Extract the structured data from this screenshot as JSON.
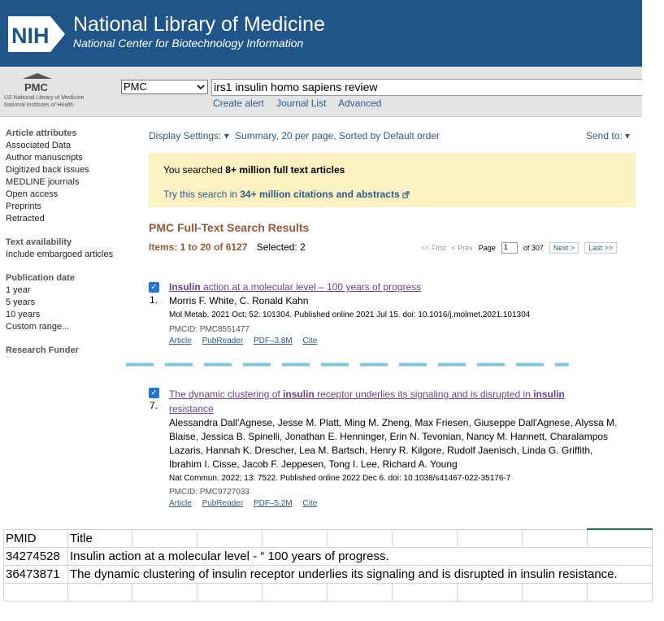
{
  "header": {
    "logo_text": "NIH",
    "title": "National Library of Medicine",
    "subtitle": "National Center for Biotechnology Information"
  },
  "search": {
    "logo_text": "PMC",
    "caption_line1": "US National Library of Medicine",
    "caption_line2": "National Institutes of Health",
    "database": "PMC",
    "query": "irs1 insulin homo sapiens review",
    "links": [
      "Create alert",
      "Journal List",
      "Advanced"
    ]
  },
  "sidebar": {
    "groups": [
      {
        "heading": "Article attributes",
        "items": [
          "Associated Data",
          "Author manuscripts",
          "Digitized back issues",
          "MEDLINE journals",
          "Open access",
          "Preprints",
          "Retracted"
        ]
      },
      {
        "heading": "Text availability",
        "items": [
          "Include embargoed articles"
        ]
      },
      {
        "heading": "Publication date",
        "items": [
          "1 year",
          "5 years",
          "10 years",
          "Custom range..."
        ]
      },
      {
        "heading": "Research Funder",
        "items": []
      }
    ]
  },
  "toolbar": {
    "display_settings": "Display Settings:",
    "display_value": "Summary, 20 per page, Sorted by Default order",
    "send_to": "Send to:"
  },
  "notice": {
    "line1_prefix": "You searched ",
    "line1_bold": "8+ million full text articles",
    "line2_prefix": "Try this search in ",
    "line2_bold": "34+ million citations and abstracts"
  },
  "results": {
    "heading": "PMC Full-Text Search Results",
    "items_label": "Items: 1 to 20 of 6127",
    "selected_label": "Selected: 2",
    "pager": {
      "first": "<< First",
      "prev": "< Prev",
      "page_label": "Page",
      "page_value": "1",
      "of_label": "of 307",
      "next": "Next >",
      "last": "Last >>"
    },
    "entries": [
      {
        "number": "1.",
        "title_pre": "",
        "title_bold": "Insulin",
        "title_post": " action at a molecular level – 100 years of progress",
        "title_line2": "",
        "authors": "Morris F. White, C. Ronald Kahn",
        "citation": "Mol Metab. 2021 Oct; 52: 101304. Published online 2021 Jul 15. doi: 10.1016/j.molmet.2021.101304",
        "pmcid": "PMCID: PMC8551477",
        "links": [
          "Article",
          "PubReader",
          "PDF–3.8M",
          "Cite"
        ]
      },
      {
        "number": "7.",
        "title_pre": "The dynamic clustering of ",
        "title_bold": "insulin",
        "title_post": " receptor underlies its signaling and is disrupted in ",
        "title_bold2": "insulin",
        "title_line2": "resistance",
        "authors": "Alessandra Dall'Agnese, Jesse M. Platt, Ming M. Zheng, Max Friesen, Giuseppe Dall'Agnese, Alyssa M. Blaise, Jessica B. Spinelli, Jonathan E. Henninger, Erin N. Tevonian, Nancy M. Hannett, Charalampos Lazaris, Hannah K. Drescher, Lea M. Bartsch, Henry R. Kilgore, Rudolf Jaenisch, Linda G. Griffith, Ibrahim I. Cisse, Jacob F. Jeppesen, Tong I. Lee, Richard A. Young",
        "citation": "Nat Commun. 2022; 13: 7522. Published online 2022 Dec 6. doi: 10.1038/s41467-022-35176-7",
        "pmcid": "PMCID: PMC9727033",
        "links": [
          "Article",
          "PubReader",
          "PDF–5.2M",
          "Cite"
        ]
      }
    ]
  },
  "spreadsheet": {
    "headers": [
      "PMID",
      "Title"
    ],
    "rows": [
      [
        "34274528",
        "Insulin action at a molecular level - “ 100 years of progress."
      ],
      [
        "36473871",
        "The dynamic clustering of insulin receptor underlies its signaling and is disrupted in insulin resistance."
      ]
    ]
  },
  "colors": {
    "nih_blue": "#20558a",
    "link_blue": "#2a5b8e",
    "heading_brown": "#985735",
    "visited_purple": "#6b3f8e",
    "notice_bg": "#fbf1c1",
    "checkbox_blue": "#1f75d0"
  }
}
